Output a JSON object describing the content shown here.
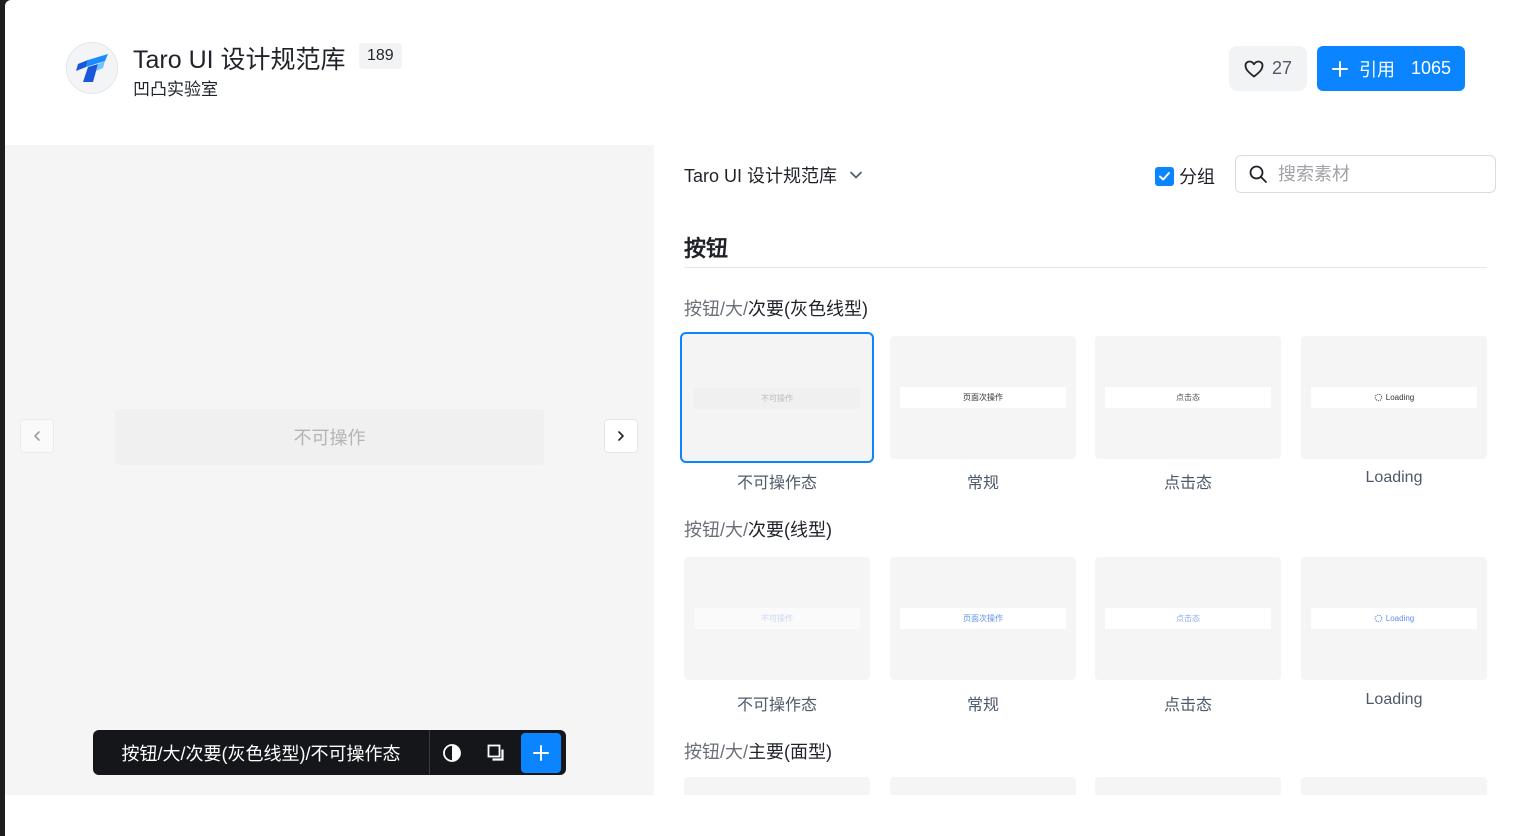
{
  "header": {
    "title": "Taro UI 设计规范库",
    "count": "189",
    "author": "凹凸实验室",
    "likes": "27",
    "reference_label": "引用",
    "reference_count": "1065"
  },
  "preview": {
    "button_text": "不可操作",
    "toolbar_label": "按钮/大/次要(灰色线型)/不可操作态"
  },
  "panel": {
    "library_name": "Taro UI 设计规范库",
    "group_label": "分组",
    "group_checked": true,
    "search_placeholder": "搜索素材",
    "section_title": "按钮",
    "groups": [
      {
        "prefix": "按钮/大/",
        "name": "次要(灰色线型)",
        "items": [
          {
            "label": "不可操作态",
            "button": "不可操作"
          },
          {
            "label": "常规",
            "button": "页面次操作"
          },
          {
            "label": "点击态",
            "button": "点击态"
          },
          {
            "label": "Loading",
            "button": "Loading"
          }
        ]
      },
      {
        "prefix": "按钮/大/",
        "name": "次要(线型)",
        "items": [
          {
            "label": "不可操作态",
            "button": "不可操作"
          },
          {
            "label": "常规",
            "button": "页面次操作"
          },
          {
            "label": "点击态",
            "button": "点击态"
          },
          {
            "label": "Loading",
            "button": "Loading"
          }
        ]
      },
      {
        "prefix": "按钮/大/",
        "name": "主要(面型)"
      }
    ]
  },
  "colors": {
    "accent": "#0a84ff",
    "toolbar_bg": "#14161a",
    "preview_bg": "#f5f5f5",
    "outline_blue": "#6190e8"
  },
  "icons": [
    "taro-logo-icon",
    "heart-icon",
    "plus-icon",
    "chevron-left-icon",
    "chevron-right-icon",
    "contrast-icon",
    "copy-icon",
    "chevron-down-icon",
    "check-icon",
    "search-icon",
    "spinner-icon"
  ]
}
